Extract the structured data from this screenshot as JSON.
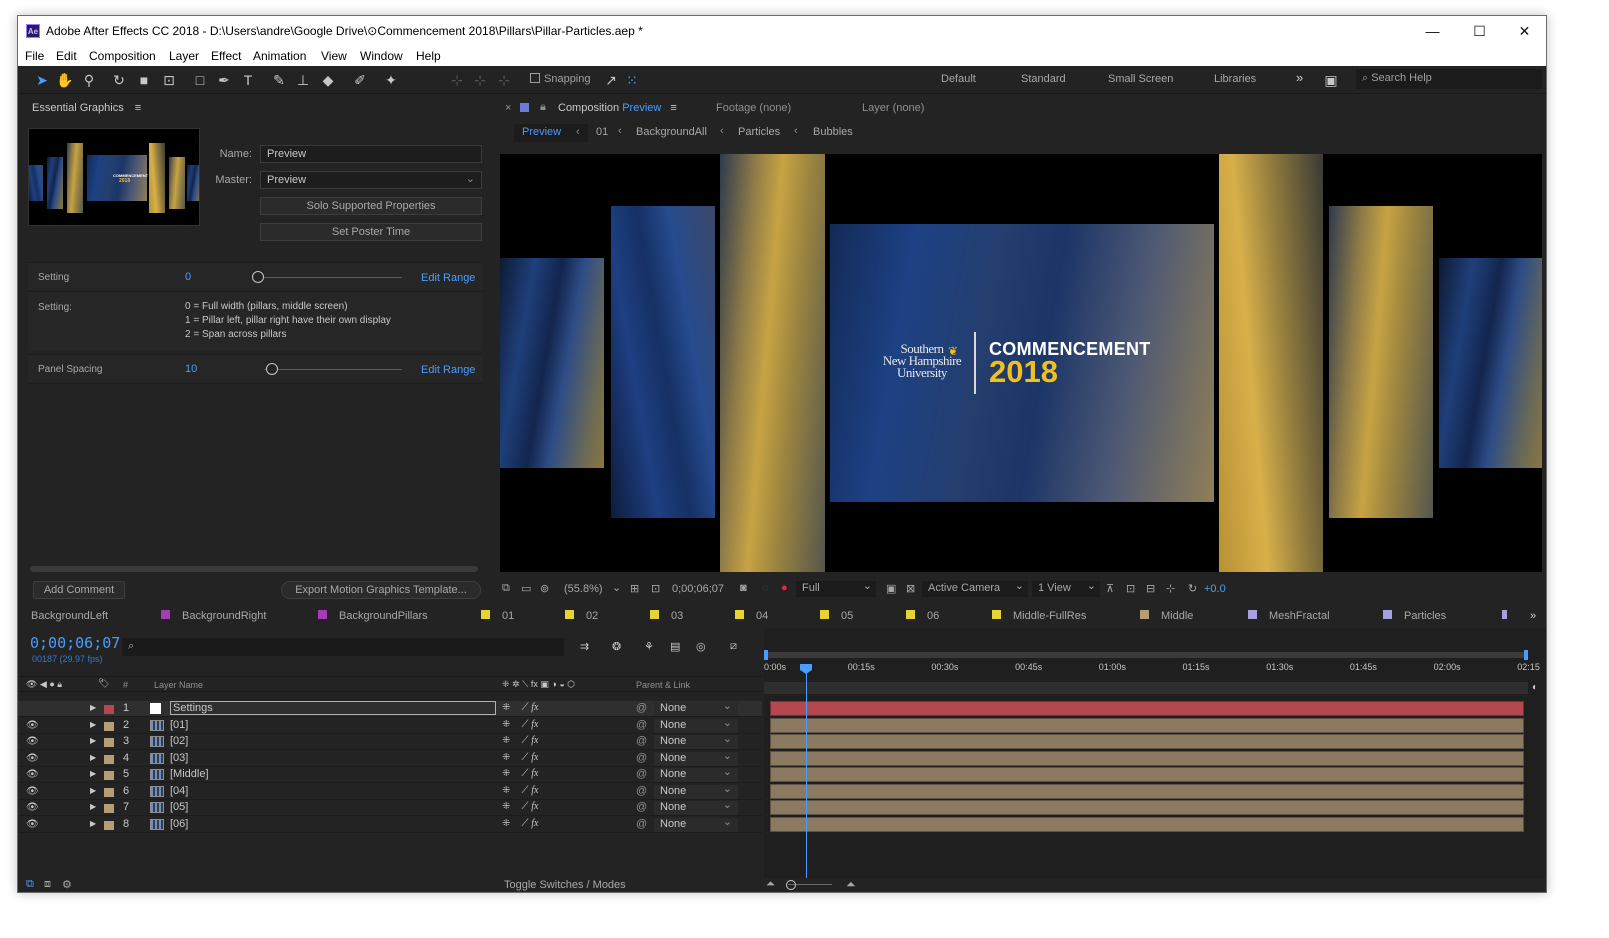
{
  "window": {
    "app_badge": "Ae",
    "title": "Adobe After Effects CC 2018 - D:\\Users\\andre\\Google Drive\\⊙Commencement 2018\\Pillars\\Pillar-Particles.aep *",
    "minimize": "—",
    "maximize": "☐",
    "close": "✕"
  },
  "menu": [
    "File",
    "Edit",
    "Composition",
    "Layer",
    "Effect",
    "Animation",
    "View",
    "Window",
    "Help"
  ],
  "toolbar": {
    "snapping": "Snapping",
    "workspaces": [
      "Default",
      "Standard",
      "Small Screen",
      "Libraries"
    ],
    "more": "»",
    "search_placeholder": "Search Help"
  },
  "essential_graphics": {
    "tab": "Essential Graphics",
    "menu_icon": "≡",
    "name_label": "Name:",
    "name_value": "Preview",
    "master_label": "Master:",
    "master_value": "Preview",
    "solo_button": "Solo Supported Properties",
    "poster_button": "Set Poster Time",
    "thumb_title": "COMMENCEMENT",
    "thumb_year": "2018",
    "properties": [
      {
        "name": "Setting",
        "value": "0",
        "edit": "Edit Range"
      },
      {
        "name": "Panel Spacing",
        "value": "10",
        "edit": "Edit Range"
      }
    ],
    "setting_desc_label": "Setting:",
    "setting_desc": [
      "0 = Full width (pillars, middle screen)",
      "1 = Pillar left, pillar right have their own display",
      "2 = Span across pillars"
    ],
    "add_comment": "Add Comment",
    "export_button": "Export Motion Graphics Template..."
  },
  "comp_panel": {
    "tab": "Composition",
    "tab_name": "Preview",
    "footage_tab": "Footage  (none)",
    "layer_tab": "Layer  (none)",
    "breadcrumbs": [
      "Preview",
      "01",
      "BackgroundAll",
      "Particles",
      "Bubbles"
    ],
    "brand_line1": "Southern",
    "brand_line2": "New Hampshire",
    "brand_line3": "University",
    "headline": "COMMENCEMENT",
    "year": "2018",
    "zoom": "(55.8%)",
    "timecode": "0;00;06;07",
    "resolution": "Full",
    "camera": "Active Camera",
    "view": "1 View",
    "exposure": "+0.0"
  },
  "layer_tabs": [
    {
      "label": "BackgroundLeft",
      "color": "#a839b8"
    },
    {
      "label": "BackgroundRight",
      "color": "#a839b8"
    },
    {
      "label": "BackgroundPillars",
      "color": "#e6d431"
    },
    {
      "label": "01",
      "color": "#e6d431"
    },
    {
      "label": "02",
      "color": "#e6d431"
    },
    {
      "label": "03",
      "color": "#e6d431"
    },
    {
      "label": "04",
      "color": "#e6d431"
    },
    {
      "label": "05",
      "color": "#e6d431"
    },
    {
      "label": "06",
      "color": "#e6d431"
    },
    {
      "label": "Middle-FullRes",
      "color": "#b59d78"
    },
    {
      "label": "Middle",
      "color": "#a6a0e0"
    },
    {
      "label": "MeshFractal",
      "color": "#a6a0e0"
    },
    {
      "label": "Particles",
      "color": "#a6a0e0"
    }
  ],
  "timeline": {
    "timecode": "0;00;06;07",
    "fps": "00187 (29.97 fps)",
    "col_layer_name": "Layer Name",
    "col_num": "#",
    "col_parent": "Parent & Link",
    "ruler": [
      "0:00s",
      "00:15s",
      "00:30s",
      "00:45s",
      "01:00s",
      "01:15s",
      "01:30s",
      "01:45s",
      "02:00s",
      "02:15"
    ],
    "layers": [
      {
        "num": "1",
        "name": "Settings",
        "parent": "None",
        "color": "#b5484e"
      },
      {
        "num": "2",
        "name": "[01]",
        "parent": "None",
        "color": "#b59d78"
      },
      {
        "num": "3",
        "name": "[02]",
        "parent": "None",
        "color": "#b59d78"
      },
      {
        "num": "4",
        "name": "[03]",
        "parent": "None",
        "color": "#b59d78"
      },
      {
        "num": "5",
        "name": "[Middle]",
        "parent": "None",
        "color": "#b59d78"
      },
      {
        "num": "6",
        "name": "[04]",
        "parent": "None",
        "color": "#b59d78"
      },
      {
        "num": "7",
        "name": "[05]",
        "parent": "None",
        "color": "#b59d78"
      },
      {
        "num": "8",
        "name": "[06]",
        "parent": "None",
        "color": "#b59d78"
      }
    ],
    "toggle": "Toggle Switches / Modes"
  }
}
